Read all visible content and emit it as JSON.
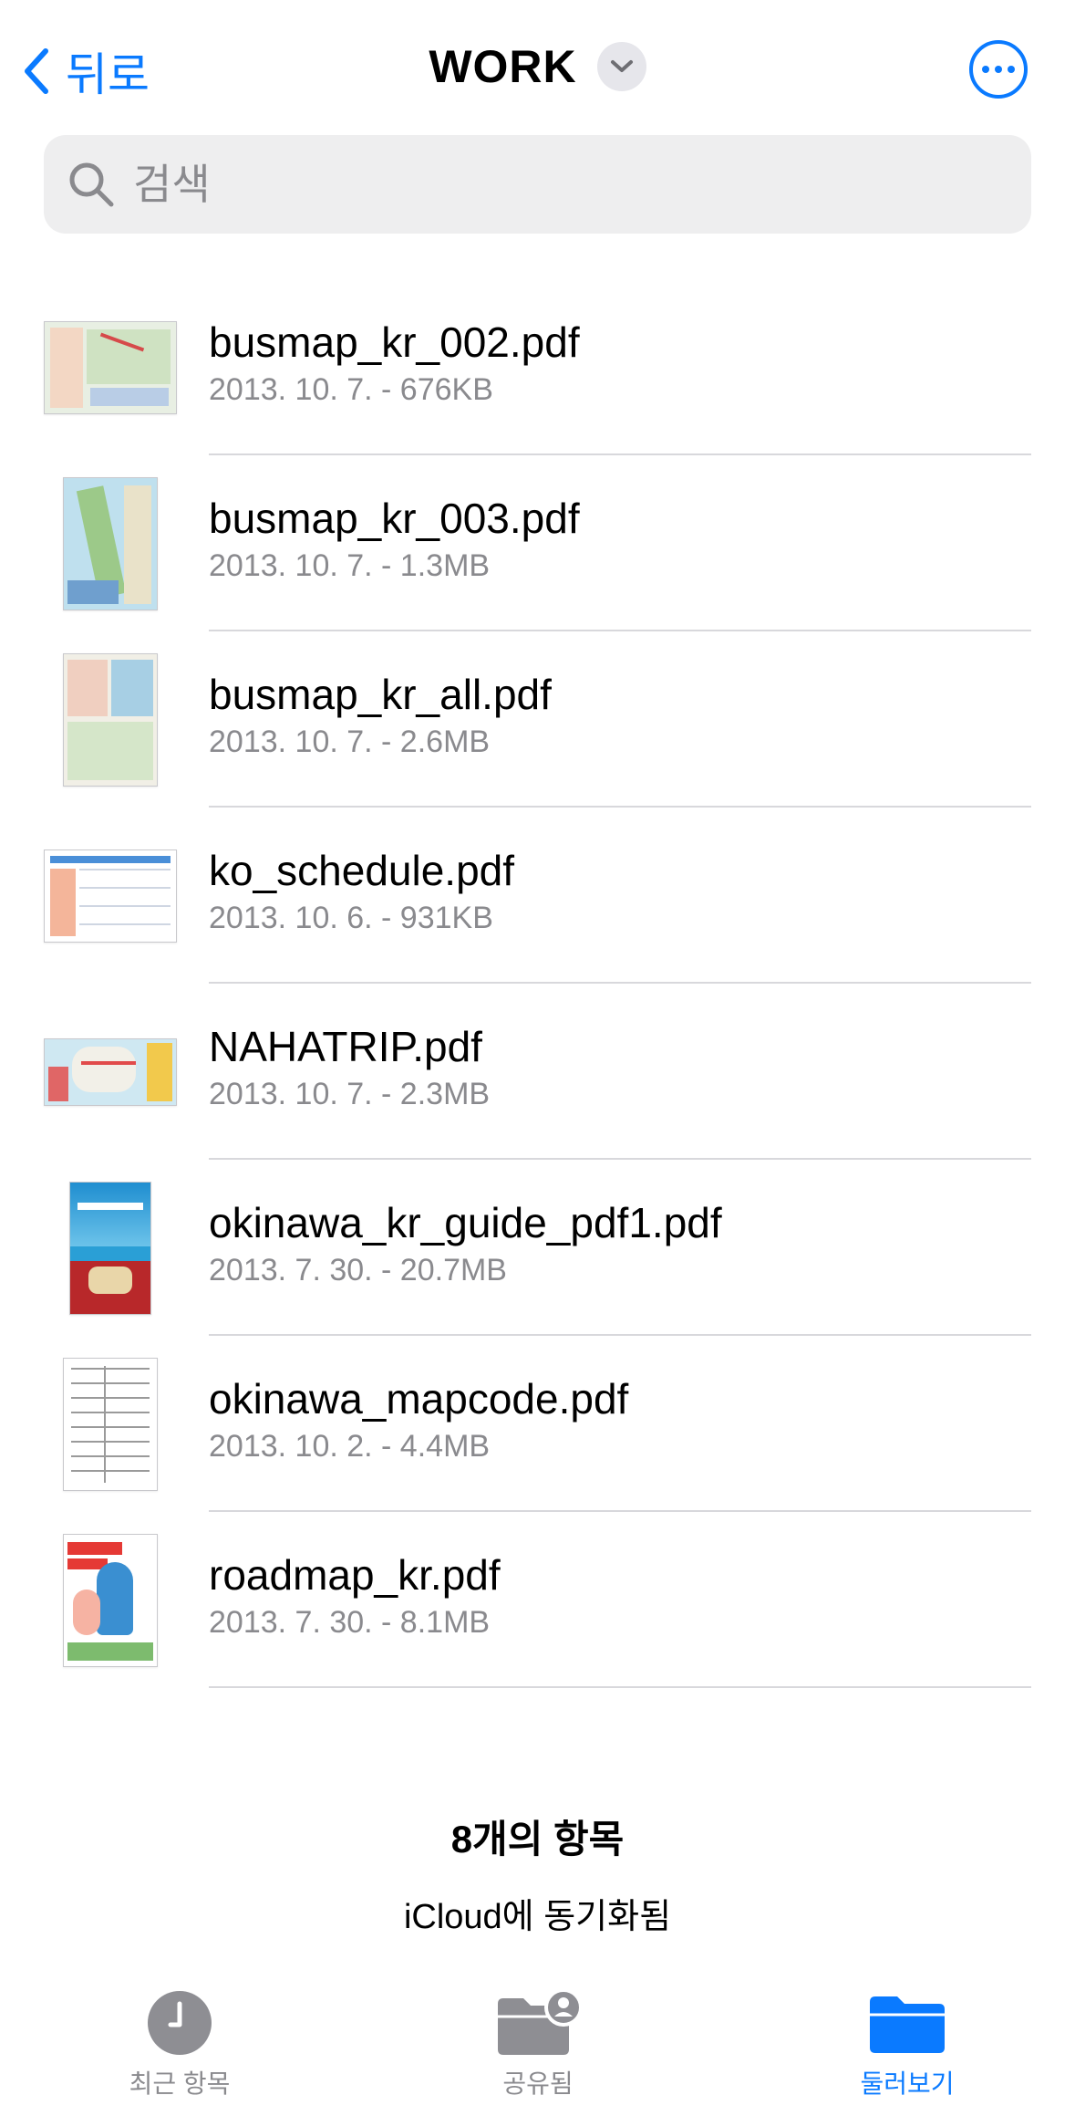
{
  "nav": {
    "back_label": "뒤로",
    "title": "WORK"
  },
  "search": {
    "placeholder": "검색"
  },
  "files": [
    {
      "name": "busmap_kr_002.pdf",
      "meta": "2013. 10. 7. - 676KB"
    },
    {
      "name": "busmap_kr_003.pdf",
      "meta": "2013. 10. 7. - 1.3MB"
    },
    {
      "name": "busmap_kr_all.pdf",
      "meta": "2013. 10. 7. - 2.6MB"
    },
    {
      "name": "ko_schedule.pdf",
      "meta": "2013. 10. 6. - 931KB"
    },
    {
      "name": "NAHATRIP.pdf",
      "meta": "2013. 10. 7. - 2.3MB"
    },
    {
      "name": "okinawa_kr_guide_pdf1.pdf",
      "meta": "2013. 7. 30. - 20.7MB"
    },
    {
      "name": "okinawa_mapcode.pdf",
      "meta": "2013. 10. 2. - 4.4MB"
    },
    {
      "name": "roadmap_kr.pdf",
      "meta": "2013. 7. 30. - 8.1MB"
    }
  ],
  "footer": {
    "count": "8개의 항목",
    "sync": "iCloud에 동기화됨"
  },
  "tabs": [
    {
      "label": "최근 항목",
      "icon": "clock-icon"
    },
    {
      "label": "공유됨",
      "icon": "shared-folder-icon"
    },
    {
      "label": "둘러보기",
      "icon": "folder-icon",
      "active": true
    }
  ],
  "colors": {
    "accent": "#0a7aff",
    "secondary_text": "#8a8a8e",
    "tab_inactive": "#8a8a8e"
  }
}
